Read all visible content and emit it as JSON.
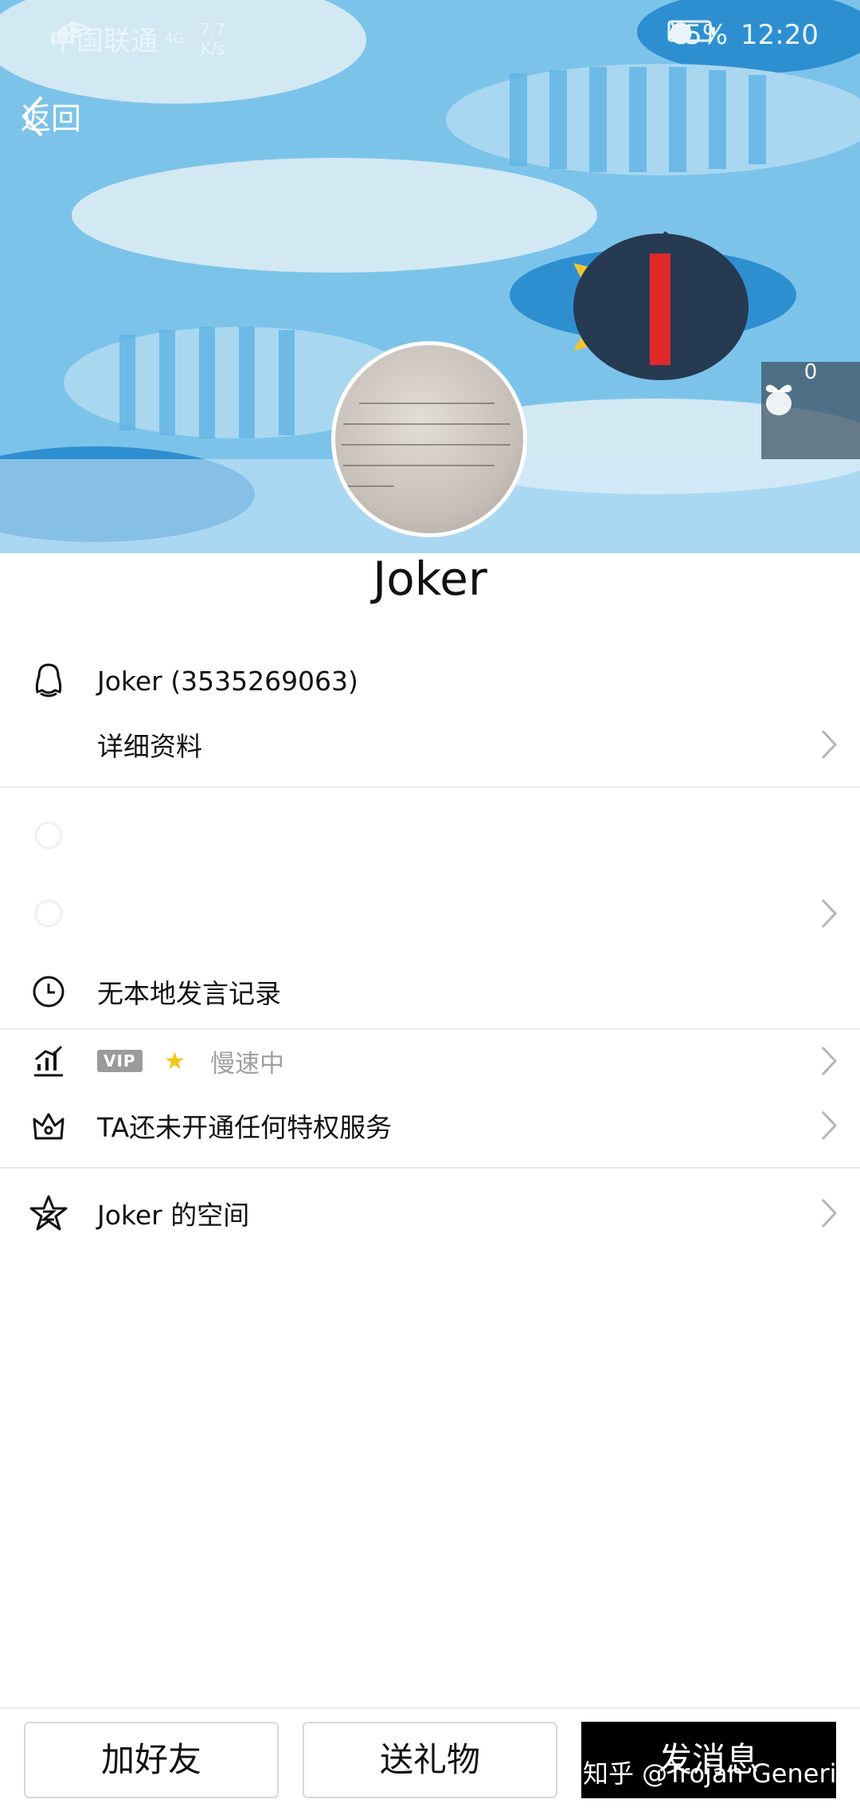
{
  "status_bar": {
    "carrier": "中国联通",
    "network": "4G",
    "speed_value": "7.7",
    "speed_unit": "K/s",
    "battery": "45%",
    "time": "12:20"
  },
  "nav": {
    "back_label": "返回"
  },
  "gift_count": "0",
  "profile": {
    "name": "Joker",
    "qq_line": "Joker (3535269063)",
    "details_label": "详细资料",
    "no_records": "无本地发言记录",
    "vip_badge": "VIP",
    "vip_status": "慢速中",
    "privilege": "TA还未开通任何特权服务",
    "space": "Joker 的空间"
  },
  "actions": {
    "add_friend": "加好友",
    "send_gift": "送礼物",
    "send_message": "发消息"
  },
  "watermark": "知乎 @Trojan Generic",
  "colors": {
    "header_bg": "#7cc3ea",
    "primary_button": "#000000",
    "divider": "#ebebeb",
    "muted_text": "#a0a0a0"
  }
}
